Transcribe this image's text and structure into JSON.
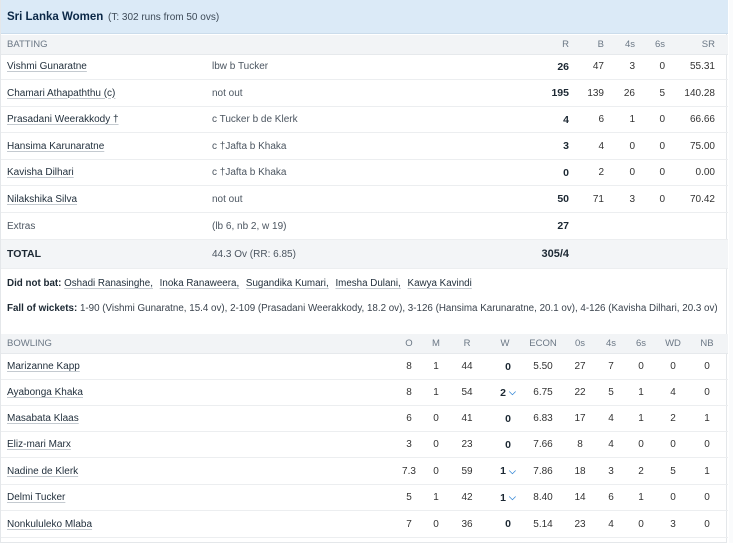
{
  "team": {
    "name": "Sri Lanka Women",
    "target": "(T: 302 runs from 50 ovs)"
  },
  "batting_header": {
    "label": "BATTING",
    "cols": [
      "R",
      "B",
      "4s",
      "6s",
      "SR"
    ]
  },
  "batters": [
    {
      "name": "Vishmi Gunaratne",
      "dismissal": "lbw b Tucker",
      "r": "26",
      "b": "47",
      "fours": "3",
      "sixes": "0",
      "sr": "55.31"
    },
    {
      "name": "Chamari Athapaththu (c)",
      "dismissal": "not out",
      "r": "195",
      "b": "139",
      "fours": "26",
      "sixes": "5",
      "sr": "140.28"
    },
    {
      "name": "Prasadani Weerakkody †",
      "dismissal": "c Tucker b de Klerk",
      "r": "4",
      "b": "6",
      "fours": "1",
      "sixes": "0",
      "sr": "66.66"
    },
    {
      "name": "Hansima Karunaratne",
      "dismissal": "c †Jafta b Khaka",
      "r": "3",
      "b": "4",
      "fours": "0",
      "sixes": "0",
      "sr": "75.00"
    },
    {
      "name": "Kavisha Dilhari",
      "dismissal": "c †Jafta b Khaka",
      "r": "0",
      "b": "2",
      "fours": "0",
      "sixes": "0",
      "sr": "0.00"
    },
    {
      "name": "Nilakshika Silva",
      "dismissal": "not out",
      "r": "50",
      "b": "71",
      "fours": "3",
      "sixes": "0",
      "sr": "70.42"
    }
  ],
  "extras": {
    "label": "Extras",
    "detail": "(lb 6, nb 2, w 19)",
    "value": "27"
  },
  "total": {
    "label": "TOTAL",
    "overs": "44.3 Ov (RR: 6.85)",
    "score": "305/4"
  },
  "did_not_bat": {
    "label": "Did not bat:",
    "players": [
      "Oshadi Ranasinghe,",
      "Inoka Ranaweera,",
      "Sugandika Kumari,",
      "Imesha Dulani,",
      "Kawya Kavindi"
    ]
  },
  "fall_of_wickets": {
    "label": "Fall of wickets:",
    "text": "1-90 (Vishmi Gunaratne, 15.4 ov), 2-109 (Prasadani Weerakkody, 18.2 ov), 3-126 (Hansima Karunaratne, 20.1 ov), 4-126 (Kavisha Dilhari, 20.3 ov)"
  },
  "bowling_header": {
    "label": "BOWLING",
    "cols": [
      "O",
      "M",
      "R",
      "W",
      "ECON",
      "0s",
      "4s",
      "6s",
      "WD",
      "NB"
    ]
  },
  "bowlers": [
    {
      "name": "Marizanne Kapp",
      "o": "8",
      "m": "1",
      "r": "44",
      "w": "0",
      "econ": "5.50",
      "zeros": "27",
      "fours": "7",
      "sixes": "0",
      "wd": "0",
      "nb": "0",
      "chev": ""
    },
    {
      "name": "Ayabonga Khaka",
      "o": "8",
      "m": "1",
      "r": "54",
      "w": "2",
      "econ": "6.75",
      "zeros": "22",
      "fours": "5",
      "sixes": "1",
      "wd": "4",
      "nb": "0",
      "chev": "⌵"
    },
    {
      "name": "Masabata Klaas",
      "o": "6",
      "m": "0",
      "r": "41",
      "w": "0",
      "econ": "6.83",
      "zeros": "17",
      "fours": "4",
      "sixes": "1",
      "wd": "2",
      "nb": "1",
      "chev": ""
    },
    {
      "name": "Eliz-mari Marx",
      "o": "3",
      "m": "0",
      "r": "23",
      "w": "0",
      "econ": "7.66",
      "zeros": "8",
      "fours": "4",
      "sixes": "0",
      "wd": "0",
      "nb": "0",
      "chev": ""
    },
    {
      "name": "Nadine de Klerk",
      "o": "7.3",
      "m": "0",
      "r": "59",
      "w": "1",
      "econ": "7.86",
      "zeros": "18",
      "fours": "3",
      "sixes": "2",
      "wd": "5",
      "nb": "1",
      "chev": "⌵"
    },
    {
      "name": "Delmi Tucker",
      "o": "5",
      "m": "1",
      "r": "42",
      "w": "1",
      "econ": "8.40",
      "zeros": "14",
      "fours": "6",
      "sixes": "1",
      "wd": "0",
      "nb": "0",
      "chev": "⌵"
    },
    {
      "name": "Nonkululeko Mlaba",
      "o": "7",
      "m": "0",
      "r": "36",
      "w": "0",
      "econ": "5.14",
      "zeros": "23",
      "fours": "4",
      "sixes": "0",
      "wd": "3",
      "nb": "0",
      "chev": ""
    }
  ]
}
